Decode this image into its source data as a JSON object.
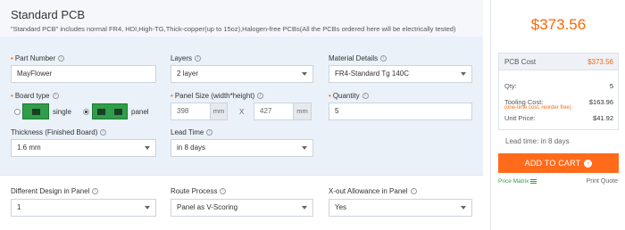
{
  "header": {
    "title": "Standard PCB",
    "subtitle": "\"Standard PCB\" includes normal FR4, HDI,High-TG,Thick-copper(up to 15oz),Halogen-free PCBs(All the PCBs ordered here will be electrically tested)"
  },
  "form": {
    "part_number": {
      "label": "Part Number",
      "value": "MayFlower"
    },
    "layers": {
      "label": "Layers",
      "value": "2 layer"
    },
    "material": {
      "label": "Material Details",
      "value": "FR4-Standard Tg 140C"
    },
    "board_type": {
      "label": "Board type",
      "option_single": "single",
      "option_panel": "panel",
      "selected": "panel"
    },
    "panel_size": {
      "label": "Panel Size (width*height)",
      "width": "398",
      "height": "427",
      "unit": "mm",
      "times": "X"
    },
    "quantity": {
      "label": "Quantity",
      "value": "5"
    },
    "thickness": {
      "label": "Thickness (Finished Board)",
      "value": "1.6 mm"
    },
    "lead_time": {
      "label": "Lead Time",
      "value": "in 8 days"
    },
    "different_design": {
      "label": "Different Design in Panel",
      "value": "1"
    },
    "route_process": {
      "label": "Route Process",
      "value": "Panel as V-Scoring"
    },
    "xout": {
      "label": "X-out Allowance in Panel",
      "value": "Yes"
    }
  },
  "summary": {
    "total": "$373.56",
    "pcb_cost_label": "PCB Cost",
    "pcb_cost_value": "$373.56",
    "qty_label": "Qty:",
    "qty_value": "5",
    "tooling_label": "Tooling Cost:",
    "tooling_note": "(one-time cost, reorder free)",
    "tooling_value": "$163.96",
    "unit_price_label": "Unit Price:",
    "unit_price_value": "$41.92",
    "lead_time": "Lead time: in 8 days",
    "add_to_cart": "ADD TO CART",
    "price_matrix": "Price Matrix",
    "print_quote": "Print Quote"
  },
  "colors": {
    "accent": "#ff6600",
    "cart_button": "#ff6b1a",
    "options_bg": "#eaf1f9",
    "board_green": "#2f9d4a"
  }
}
